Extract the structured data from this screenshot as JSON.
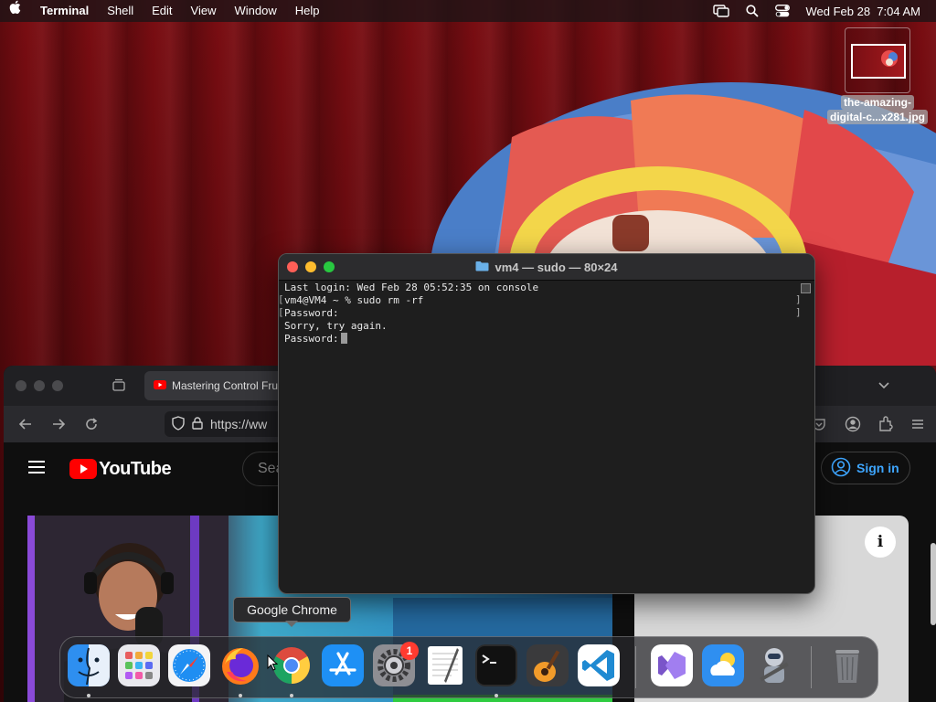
{
  "menubar": {
    "app_name": "Terminal",
    "menus": [
      "Shell",
      "Edit",
      "View",
      "Window",
      "Help"
    ],
    "datetime": "Wed Feb 28  7:04 AM"
  },
  "desktop_file": {
    "label_line1": "the-amazing-",
    "label_line2": "digital-c...x281.jpg"
  },
  "browser": {
    "tab_title": "Mastering Control Frui",
    "url": "https://ww",
    "youtube": {
      "logo_text": "YouTube",
      "search_placeholder": "Sea",
      "signin_label": "Sign in",
      "info_label": "i"
    }
  },
  "terminal": {
    "title": "vm4 — sudo — 80×24",
    "lines": [
      "Last login: Wed Feb 28 05:52:35 on console",
      "vm4@VM4 ~ % sudo rm -rf",
      "Password:",
      "Sorry, try again.",
      "Password:"
    ]
  },
  "tooltip": "Google Chrome",
  "dock": {
    "badge_count": "1",
    "apps": [
      "Finder",
      "Launchpad",
      "Safari",
      "Firefox",
      "Google Chrome",
      "App Store",
      "System Settings",
      "TextEdit",
      "Terminal",
      "GarageBand",
      "Visual Studio Code",
      "Visual Studio",
      "Weather",
      "Automator",
      "Trash"
    ]
  },
  "colors": {
    "accent_link": "#3ea6ff",
    "close": "#ff5f57",
    "minimize": "#febc2e",
    "zoom": "#28c840",
    "youtube_red": "#ff0000"
  }
}
